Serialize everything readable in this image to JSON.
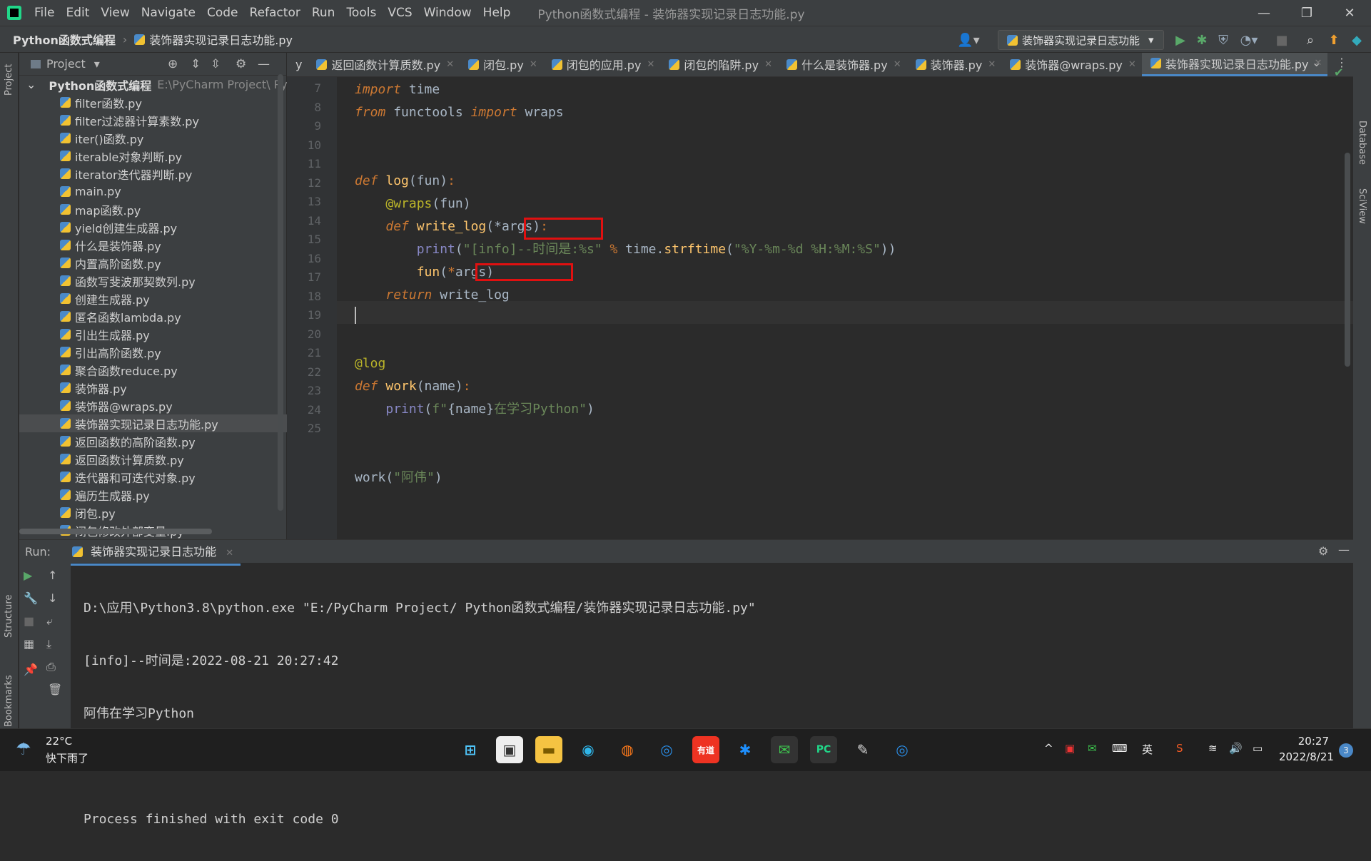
{
  "menubar": {
    "items": [
      "File",
      "Edit",
      "View",
      "Navigate",
      "Code",
      "Refactor",
      "Run",
      "Tools",
      "VCS",
      "Window",
      "Help"
    ],
    "window_title": "Python函数式编程 - 装饰器实现记录日志功能.py"
  },
  "navbar": {
    "project": "Python函数式编程",
    "file": "装饰器实现记录日志功能.py",
    "run_config": "装饰器实现记录日志功能"
  },
  "project_panel": {
    "title": "Project",
    "root_name": "Python函数式编程",
    "root_path": "E:\\PyCharm Project\\ Pyth",
    "files": [
      "filter函数.py",
      "filter过滤器计算素数.py",
      "iter()函数.py",
      "iterable对象判断.py",
      "iterator迭代器判断.py",
      "main.py",
      "map函数.py",
      "yield创建生成器.py",
      "什么是装饰器.py",
      "内置高阶函数.py",
      "函数写斐波那契数列.py",
      "创建生成器.py",
      "匿名函数lambda.py",
      "引出生成器.py",
      "引出高阶函数.py",
      "聚合函数reduce.py",
      "装饰器.py",
      "装饰器@wraps.py",
      "装饰器实现记录日志功能.py",
      "返回函数的高阶函数.py",
      "返回函数计算质数.py",
      "迭代器和可迭代对象.py",
      "遍历生成器.py",
      "闭包.py",
      "闭包修改外部变量.py"
    ],
    "selected": "装饰器实现记录日志功能.py"
  },
  "editor": {
    "tabs": [
      "y",
      "返回函数计算质数.py",
      "闭包.py",
      "闭包的应用.py",
      "闭包的陷阱.py",
      "什么是装饰器.py",
      "装饰器.py",
      "装饰器@wraps.py",
      "装饰器实现记录日志功能.py"
    ],
    "active_tab": "装饰器实现记录日志功能.py",
    "line_numbers": [
      "7",
      "8",
      "9",
      "10",
      "11",
      "12",
      "13",
      "14",
      "15",
      "16",
      "17",
      "18",
      "19",
      "20",
      "21",
      "22",
      "23",
      "24",
      "25"
    ]
  },
  "run_panel": {
    "label": "Run:",
    "tab": "装饰器实现记录日志功能",
    "output": [
      "D:\\应用\\Python3.8\\python.exe \"E:/PyCharm Project/ Python函数式编程/装饰器实现记录日志功能.py\"",
      "[info]--时间是:2022-08-21 20:27:42",
      "阿伟在学习Python",
      "",
      "Process finished with exit code 0"
    ]
  },
  "side_labels": {
    "project": "Project",
    "structure": "Structure",
    "bookmarks": "Bookmarks",
    "database": "Database",
    "sciview": "SciView"
  },
  "taskbar": {
    "weather_temp": "22°C",
    "weather_desc": "快下雨了",
    "ime": "英",
    "time": "20:27",
    "date": "2022/8/21",
    "notif_count": "3",
    "youdao": "有道"
  },
  "colors": {
    "accent": "#4a88c7",
    "keyword": "#cc7832",
    "string": "#6a8759",
    "function": "#ffc66d",
    "highlight_box": "#e01010"
  }
}
